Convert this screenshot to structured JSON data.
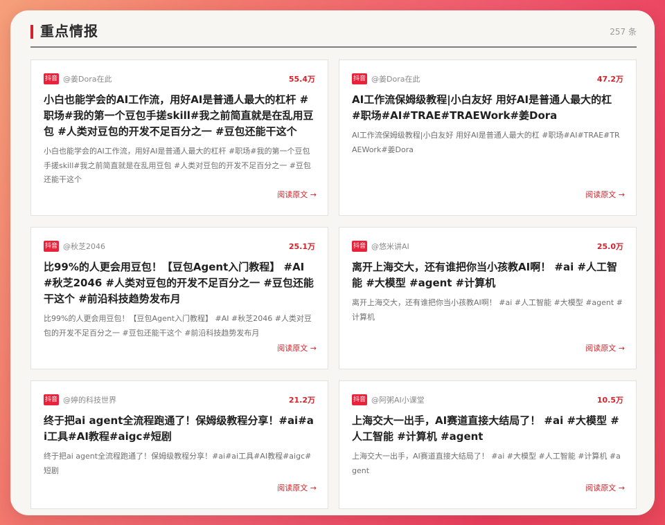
{
  "header": {
    "title": "重点情报",
    "count": "257 条"
  },
  "colors": {
    "accent": "#d2232a",
    "badge": "#e8223a"
  },
  "cards": [
    {
      "platform": "抖音",
      "author": "@姜Dora在此",
      "metric": "55.4万",
      "title": "小白也能学会的AI工作流，用好AI是普通人最大的杠杆 #职场#我的第一个豆包手搓skill#我之前简直就是在乱用豆包 #人类对豆包的开发不足百分之一 #豆包还能干这个",
      "summary": "小白也能学会的AI工作流，用好AI是普通人最大的杠杆 #职场#我的第一个豆包手搓skill#我之前简直就是在乱用豆包 #人类对豆包的开发不足百分之一 #豆包还能干这个",
      "link": "阅读原文 →"
    },
    {
      "platform": "抖音",
      "author": "@姜Dora在此",
      "metric": "47.2万",
      "title": "AI工作流保姆级教程|小白友好 用好AI是普通人最大的杠 #职场#AI#TRAE#TRAEWork#姜Dora",
      "summary": "AI工作流保姆级教程|小白友好 用好AI是普通人最大的杠 #职场#AI#TRAE#TRAEWork#姜Dora",
      "link": "阅读原文 →"
    },
    {
      "platform": "抖音",
      "author": "@秋芝2046",
      "metric": "25.1万",
      "title": "比99%的人更会用豆包！【豆包Agent入门教程】 #AI #秋芝2046 #人类对豆包的开发不足百分之一 #豆包还能干这个 #前沿科技趋势发布月",
      "summary": "比99%的人更会用豆包！【豆包Agent入门教程】 #AI #秋芝2046 #人类对豆包的开发不足百分之一 #豆包还能干这个 #前沿科技趋势发布月",
      "link": "阅读原文 →"
    },
    {
      "platform": "抖音",
      "author": "@悠米讲AI",
      "metric": "25.0万",
      "title": "离开上海交大，还有谁把你当小孩教AI啊！ #ai #人工智能 #大模型 #agent #计算机",
      "summary": "离开上海交大，还有谁把你当小孩教AI啊！ #ai #人工智能 #大模型 #agent #计算机",
      "link": "阅读原文 →"
    },
    {
      "platform": "抖音",
      "author": "@婷的科技世界",
      "metric": "21.2万",
      "title": "终于把ai agent全流程跑通了！保姆级教程分享！#ai#ai工具#AI教程#aigc#短剧",
      "summary": "终于把ai agent全流程跑通了！保姆级教程分享！#ai#ai工具#AI教程#aigc#短剧",
      "link": "阅读原文 →"
    },
    {
      "platform": "抖音",
      "author": "@阿粥AI小课堂",
      "metric": "10.5万",
      "title": "上海交大一出手，AI赛道直接大结局了！ #ai #大模型 #人工智能 #计算机 #agent",
      "summary": "上海交大一出手，AI赛道直接大结局了！ #ai #大模型 #人工智能 #计算机 #agent",
      "link": "阅读原文 →"
    }
  ]
}
